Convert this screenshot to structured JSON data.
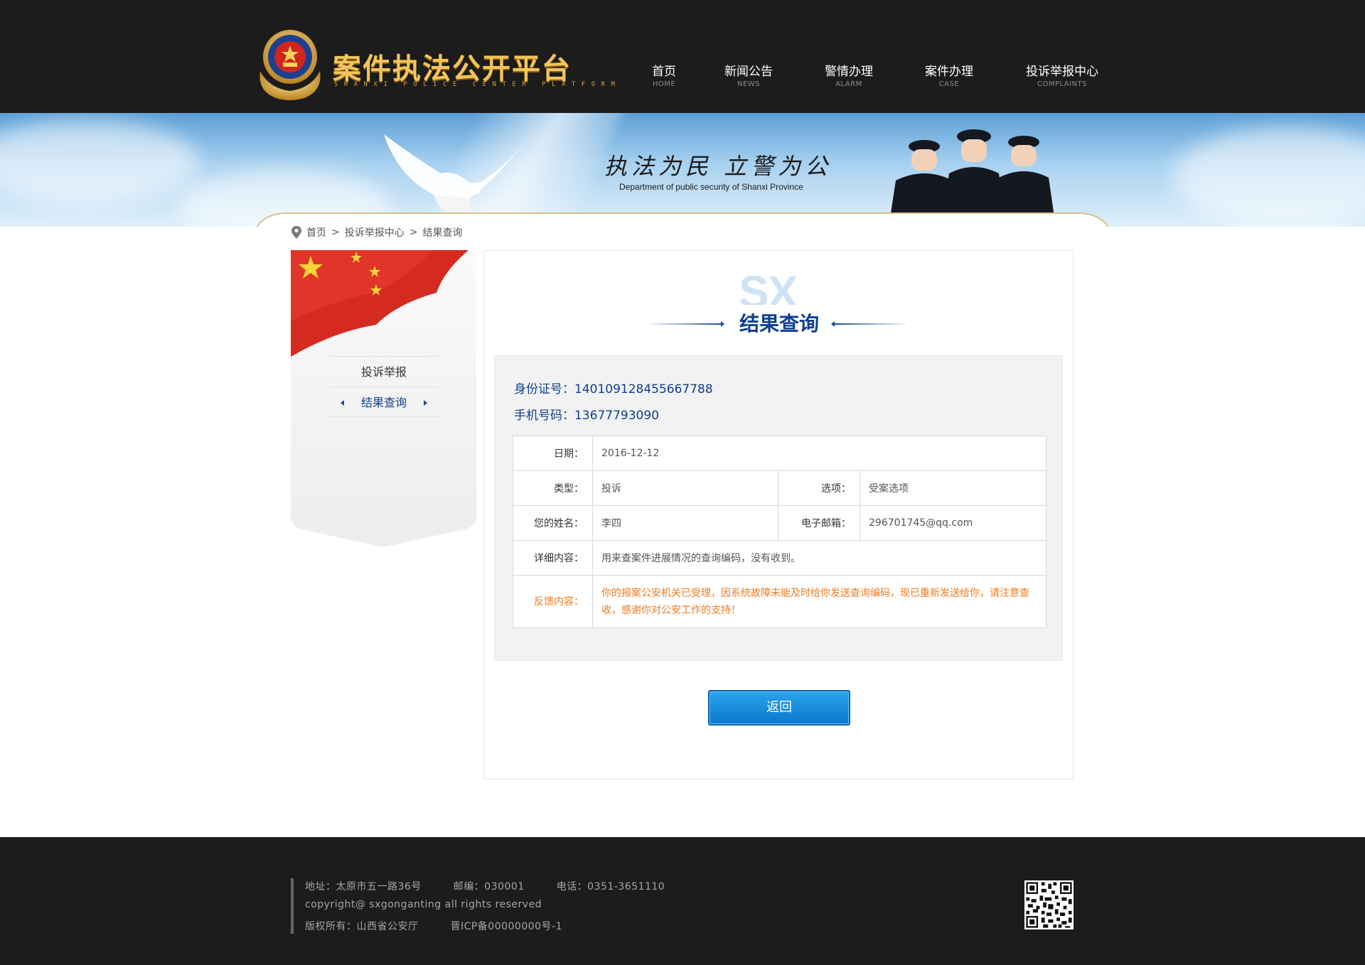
{
  "header": {
    "logo_title": "案件执法公开平台",
    "logo_subtitle": "SHANXI POLICE CENTER PLATFORM",
    "nav": [
      {
        "label": "首页",
        "sub": "HOME"
      },
      {
        "label": "新闻公告",
        "sub": "NEWS"
      },
      {
        "label": "警情办理",
        "sub": "ALARM"
      },
      {
        "label": "案件办理",
        "sub": "CASE"
      },
      {
        "label": "投诉举报中心",
        "sub": "COMPLAINTS"
      }
    ]
  },
  "banner": {
    "slogan": "执法为民 立警为公",
    "slogan_en": "Department of public security of Shanxi Province"
  },
  "breadcrumb": {
    "items": [
      "首页",
      "投诉举报中心",
      "结果查询"
    ],
    "separator": ">"
  },
  "sidebar": {
    "items": [
      {
        "label": "投诉举报",
        "active": false
      },
      {
        "label": "结果查询",
        "active": true
      }
    ]
  },
  "main": {
    "watermark": "SX",
    "title": "结果查询",
    "id_label": "身份证号：",
    "id_value": "140109128455667788",
    "phone_label": "手机号码：",
    "phone_value": "13677793090",
    "table": {
      "date_label": "日期：",
      "date_value": "2016-12-12",
      "type_label": "类型：",
      "type_value": "投诉",
      "option_label": "选项：",
      "option_value": "受案选项",
      "name_label": "您的姓名：",
      "name_value": "李四",
      "email_label": "电子邮箱：",
      "email_value": "296701745@qq.com",
      "detail_label": "详细内容：",
      "detail_value": "用来查案件进展情况的查询编码，没有收到。",
      "feedback_label": "反馈内容：",
      "feedback_value": "你的报案公安机关已受理，因系统故障未能及时给你发送查询编码，现已重新发送给你，请注意查收，感谢你对公安工作的支持！"
    },
    "back_button": "返回"
  },
  "footer": {
    "address": "地址：太原市五一路36号",
    "postcode": "邮编：030001",
    "phone": "电话：0351-3651110",
    "copyright": "copyright@ sxgonganting all rights reserved",
    "owner": "版权所有：山西省公安厅",
    "icp": "晋ICP备00000000号-1"
  },
  "colors": {
    "header_bg": "#1c1c1c",
    "title_blue": "#0f3f8f",
    "feedback_orange": "#f07a1e",
    "button_blue": "#0a78cc"
  }
}
